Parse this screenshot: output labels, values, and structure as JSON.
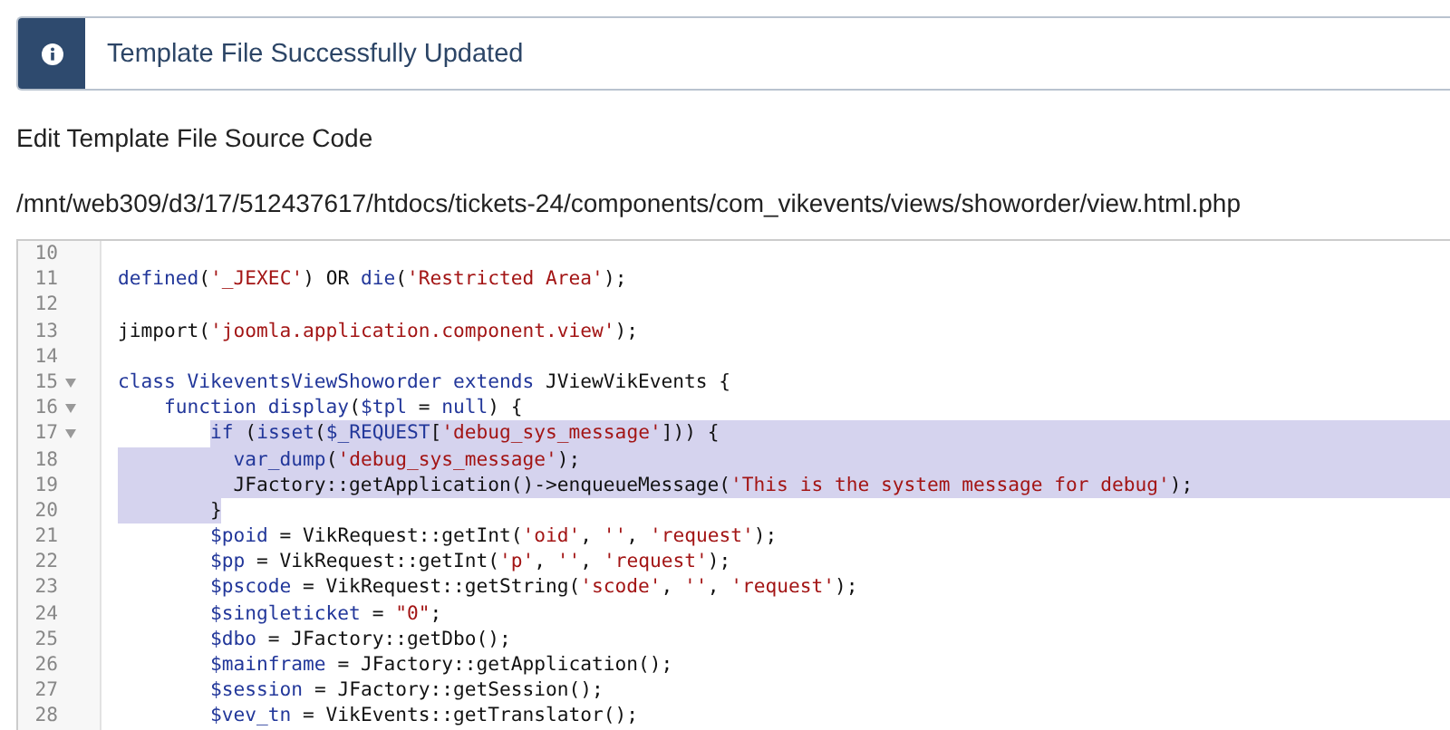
{
  "alert": {
    "kind": "info",
    "message": "Template File Successfully Updated"
  },
  "heading": "Edit Template File Source Code",
  "file_path": "/mnt/web309/d3/17/512437617/htdocs/tickets-24/components/com_vikevents/views/showorder/view.html.php",
  "editor": {
    "lines": [
      {
        "number": "10",
        "fold": false,
        "selected": false
      },
      {
        "number": "11",
        "fold": false,
        "selected": false,
        "tokens": [
          {
            "kind": "kw",
            "text": "defined"
          },
          {
            "kind": "plain",
            "text": "("
          },
          {
            "kind": "str",
            "text": "'_JEXEC'"
          },
          {
            "kind": "plain",
            "text": ") OR "
          },
          {
            "kind": "kw",
            "text": "die"
          },
          {
            "kind": "plain",
            "text": "("
          },
          {
            "kind": "str",
            "text": "'Restricted Area'"
          },
          {
            "kind": "plain",
            "text": ");"
          }
        ]
      },
      {
        "number": "12",
        "fold": false,
        "selected": false
      },
      {
        "number": "13",
        "fold": false,
        "selected": false,
        "tokens": [
          {
            "kind": "plain",
            "text": "jimport("
          },
          {
            "kind": "str",
            "text": "'joomla.application.component.view'"
          },
          {
            "kind": "plain",
            "text": ");"
          }
        ]
      },
      {
        "number": "14",
        "fold": false,
        "selected": false
      },
      {
        "number": "15",
        "fold": true,
        "selected": false,
        "tokens": [
          {
            "kind": "kw",
            "text": "class VikeventsViewShoworder extends"
          },
          {
            "kind": "plain",
            "text": " JViewVikEvents {"
          }
        ]
      },
      {
        "number": "16",
        "fold": true,
        "selected": false,
        "tokens": [
          {
            "kind": "kw",
            "text": "    function display"
          },
          {
            "kind": "plain",
            "text": "("
          },
          {
            "kind": "kw",
            "text": "$tpl"
          },
          {
            "kind": "plain",
            "text": " = "
          },
          {
            "kind": "kw",
            "text": "null"
          },
          {
            "kind": "plain",
            "text": ") {"
          }
        ]
      },
      {
        "number": "17",
        "fold": true,
        "selected": true,
        "tokens": [
          {
            "kind": "kw",
            "text": "        if"
          },
          {
            "kind": "plain",
            "text": " ("
          },
          {
            "kind": "kw",
            "text": "isset"
          },
          {
            "kind": "plain",
            "text": "("
          },
          {
            "kind": "kw",
            "text": "$_REQUEST"
          },
          {
            "kind": "plain",
            "text": "["
          },
          {
            "kind": "str",
            "text": "'debug_sys_message'"
          },
          {
            "kind": "plain",
            "text": "])) {"
          }
        ]
      },
      {
        "number": "18",
        "fold": false,
        "selected": true,
        "tokens": [
          {
            "kind": "kw",
            "text": "          var_dump"
          },
          {
            "kind": "plain",
            "text": "("
          },
          {
            "kind": "str",
            "text": "'debug_sys_message'"
          },
          {
            "kind": "plain",
            "text": ");"
          }
        ]
      },
      {
        "number": "19",
        "fold": false,
        "selected": true,
        "tokens": [
          {
            "kind": "plain",
            "text": "          JFactory::getApplication()->enqueueMessage("
          },
          {
            "kind": "str",
            "text": "'This is the system message for debug'"
          },
          {
            "kind": "plain",
            "text": ");"
          }
        ]
      },
      {
        "number": "20",
        "fold": false,
        "selected": true,
        "tokens": [
          {
            "kind": "plain",
            "text": "        }"
          }
        ]
      },
      {
        "number": "21",
        "fold": false,
        "selected": false,
        "tokens": [
          {
            "kind": "kw",
            "text": "        $poid"
          },
          {
            "kind": "plain",
            "text": " = VikRequest::getInt("
          },
          {
            "kind": "str",
            "text": "'oid'"
          },
          {
            "kind": "plain",
            "text": ", "
          },
          {
            "kind": "str",
            "text": "''"
          },
          {
            "kind": "plain",
            "text": ", "
          },
          {
            "kind": "str",
            "text": "'request'"
          },
          {
            "kind": "plain",
            "text": ");"
          }
        ]
      },
      {
        "number": "22",
        "fold": false,
        "selected": false,
        "tokens": [
          {
            "kind": "kw",
            "text": "        $pp"
          },
          {
            "kind": "plain",
            "text": " = VikRequest::getInt("
          },
          {
            "kind": "str",
            "text": "'p'"
          },
          {
            "kind": "plain",
            "text": ", "
          },
          {
            "kind": "str",
            "text": "''"
          },
          {
            "kind": "plain",
            "text": ", "
          },
          {
            "kind": "str",
            "text": "'request'"
          },
          {
            "kind": "plain",
            "text": ");"
          }
        ]
      },
      {
        "number": "23",
        "fold": false,
        "selected": false,
        "tokens": [
          {
            "kind": "kw",
            "text": "        $pscode"
          },
          {
            "kind": "plain",
            "text": " = VikRequest::getString("
          },
          {
            "kind": "str",
            "text": "'scode'"
          },
          {
            "kind": "plain",
            "text": ", "
          },
          {
            "kind": "str",
            "text": "''"
          },
          {
            "kind": "plain",
            "text": ", "
          },
          {
            "kind": "str",
            "text": "'request'"
          },
          {
            "kind": "plain",
            "text": ");"
          }
        ]
      },
      {
        "number": "24",
        "fold": false,
        "selected": false,
        "tokens": [
          {
            "kind": "kw",
            "text": "        $singleticket"
          },
          {
            "kind": "plain",
            "text": " = "
          },
          {
            "kind": "str",
            "text": "\"0\""
          },
          {
            "kind": "plain",
            "text": ";"
          }
        ]
      },
      {
        "number": "25",
        "fold": false,
        "selected": false,
        "tokens": [
          {
            "kind": "kw",
            "text": "        $dbo"
          },
          {
            "kind": "plain",
            "text": " = JFactory::getDbo();"
          }
        ]
      },
      {
        "number": "26",
        "fold": false,
        "selected": false,
        "tokens": [
          {
            "kind": "kw",
            "text": "        $mainframe"
          },
          {
            "kind": "plain",
            "text": " = JFactory::getApplication();"
          }
        ]
      },
      {
        "number": "27",
        "fold": false,
        "selected": false,
        "tokens": [
          {
            "kind": "kw",
            "text": "        $session"
          },
          {
            "kind": "plain",
            "text": " = JFactory::getSession();"
          }
        ]
      },
      {
        "number": "28",
        "fold": false,
        "selected": false,
        "tokens": [
          {
            "kind": "kw",
            "text": "        $vev_tn"
          },
          {
            "kind": "plain",
            "text": " = VikEvents::getTranslator();"
          }
        ]
      }
    ]
  }
}
